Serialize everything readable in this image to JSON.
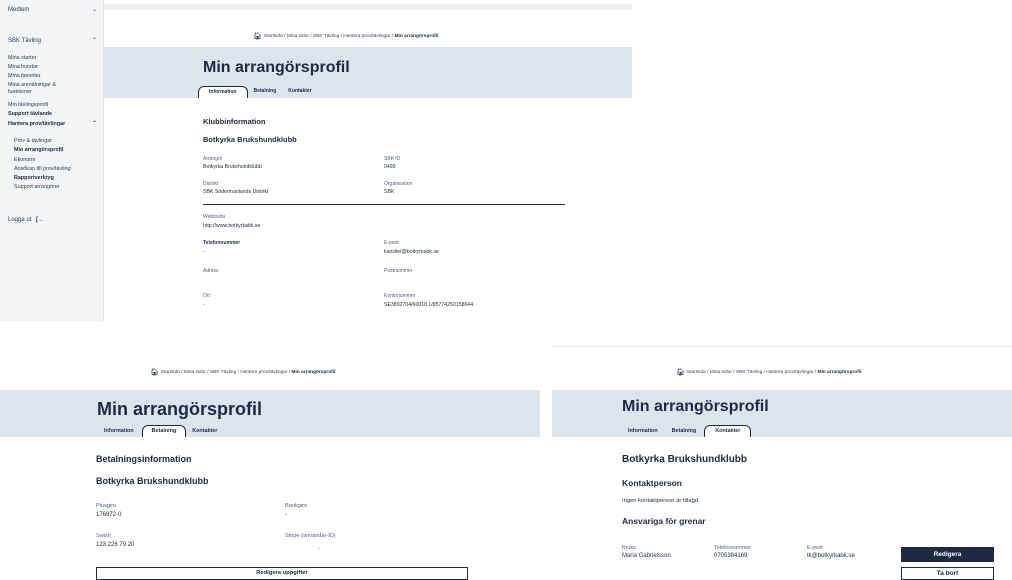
{
  "sidebar": {
    "items": [
      {
        "label": "Medlem",
        "chevron": "⌄"
      },
      {
        "label": "SBK Tävling",
        "chevron": "⌃"
      },
      {
        "label": "Mina starter"
      },
      {
        "label": "Mina hundar"
      },
      {
        "label": "Mina favoriter"
      },
      {
        "label": "Mina anmälningar & funktioner"
      },
      {
        "label": "Min tävlingsprofil"
      },
      {
        "label": "Support tävlande"
      },
      {
        "label": "Hantera prov/tävlingar",
        "chevron": "⌃"
      },
      {
        "label": "Prov & tävlingar"
      },
      {
        "label": "Min arrangörsprofil"
      },
      {
        "label": "Ekonomi"
      },
      {
        "label": "Ansökan till prov/tävling"
      },
      {
        "label": "Rapportverktyg"
      },
      {
        "label": "Support arrangörer"
      }
    ],
    "logout": "Logga ut",
    "logout_icon": "logout-arrow-icon"
  },
  "breadcrumb": {
    "home_icon": "house-icon",
    "path": "Startsida / Mina sidor / SBK Tävling / Hantera prov/tävlingar / ",
    "current": "Min arrangörsprofil"
  },
  "page_title": "Min arrangörsprofil",
  "tabs": [
    "Information",
    "Betalning",
    "Kontakter"
  ],
  "info": {
    "section_title": "Klubbinformation",
    "club_name": "Botkyrka Brukshundklubb",
    "arrangor_label": "Arrangör",
    "arrangor_value": "Botkyrka Brukshundklubb",
    "sbkid_label": "SBK ID",
    "sbkid_value": "0499",
    "distrikt_label": "Distrikt",
    "distrikt_value": "SBK Södermanlands Distrikt",
    "org_label": "Organisation",
    "org_value": "SBK",
    "web_label": "Webbsida",
    "web_value": "http://www.botkyrkabk.se",
    "phone_label": "Telefonnummer",
    "phone_value": "-",
    "email_label": "E-post",
    "email_value": "kansliet@botkyrkabk.se",
    "address_label": "Adress",
    "postal_label": "Postnummer",
    "city_label": "Ort",
    "city_value": "-",
    "account_label": "Kontonummer",
    "account_value": "SE3892704/60018 1/85774250158644"
  },
  "payment": {
    "section_title": "Betalningsinformation",
    "club_name": "Botkyrka Brukshundklubb",
    "plusgiro_label": "Plusgiro",
    "plusgiro_value": "176872-0",
    "bankgiro_label": "Bankgiro",
    "bankgiro_value": "-",
    "swish_label": "Swish",
    "swish_value": "123 226 79 20",
    "stripe_label": "Stripe (användar-ID)",
    "stripe_value": "-",
    "edit_button": "Redigera uppgifter"
  },
  "contacts": {
    "club_name": "Botkyrka Brukshundklubb",
    "contact_title": "Kontaktperson",
    "contact_empty": "Ingen kontaktperson är tillagd.",
    "responsible_title": "Ansvariga för grenar",
    "col_branch": "Bruks",
    "col_phone": "Telefonnummer",
    "col_email": "E-post",
    "person_name": "Maria Gabrielsson",
    "person_phone": "0705384169",
    "person_email": "tk@botkyrkabk.se",
    "edit_button": "Redigera",
    "remove_button": "Ta bort"
  },
  "colors": {
    "navy": "#1c2a44",
    "band": "#dce4ec",
    "sidebar": "#f4f5f7"
  }
}
